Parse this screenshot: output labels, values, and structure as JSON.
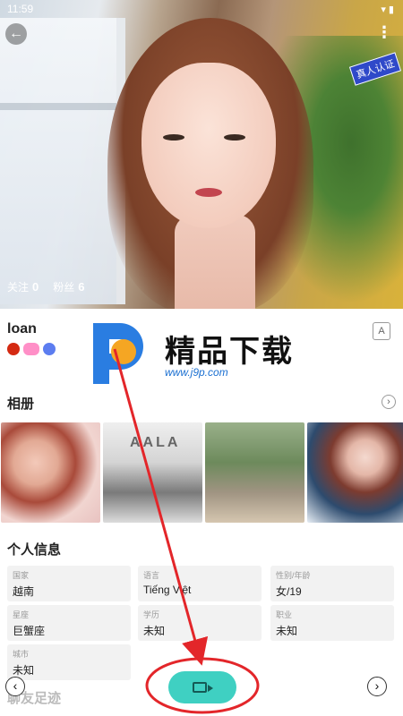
{
  "status_bar": {
    "time": "11:59",
    "icons": "▾ ▮"
  },
  "hero": {
    "verify_badge": "真人认证",
    "follow_label": "关注",
    "follow_count": "0",
    "fans_label": "粉丝",
    "fans_count": "6"
  },
  "profile": {
    "username": "loan",
    "translate_icon": "A"
  },
  "watermark": {
    "title": "精品下载",
    "url": "www.j9p.com"
  },
  "album": {
    "title": "相册",
    "more": "›",
    "photo2_sign": "AALA"
  },
  "info": {
    "title": "个人信息",
    "cells": [
      {
        "key": "国家",
        "value": "越南"
      },
      {
        "key": "语言",
        "value": "Tiếng Việt"
      },
      {
        "key": "性别/年龄",
        "value": "女/19"
      },
      {
        "key": "星座",
        "value": "巨蟹座"
      },
      {
        "key": "学历",
        "value": "未知"
      },
      {
        "key": "职业",
        "value": "未知"
      },
      {
        "key": "城市",
        "value": "未知"
      }
    ]
  },
  "footprint": {
    "title": "聊友足迹"
  },
  "nav": {
    "prev": "‹",
    "next": "›"
  },
  "colors": {
    "accent": "#3fd0c2",
    "annotation_red": "#e3262a",
    "verify_blue": "#2f49c9"
  }
}
